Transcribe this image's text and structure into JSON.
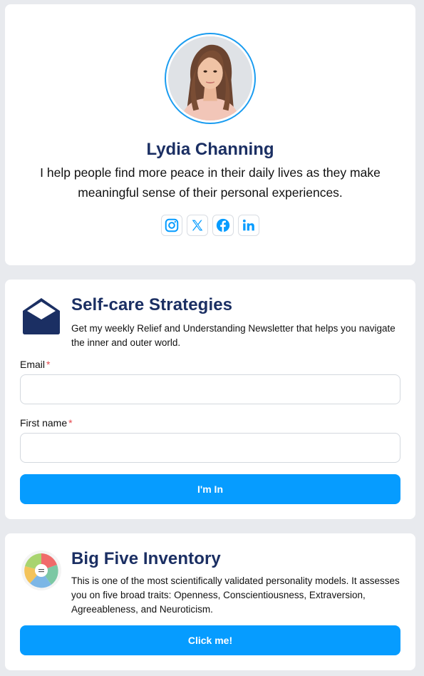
{
  "profile": {
    "name": "Lydia Channing",
    "bio": "I help people find more peace in their daily lives as they make meaningful sense of their personal experiences.",
    "avatar_icon": "portrait-photo",
    "socials": [
      {
        "name": "instagram",
        "icon": "instagram-icon"
      },
      {
        "name": "x",
        "icon": "x-icon"
      },
      {
        "name": "facebook",
        "icon": "facebook-icon"
      },
      {
        "name": "linkedin",
        "icon": "linkedin-icon"
      }
    ]
  },
  "newsletter": {
    "icon": "envelope-icon",
    "title": "Self-care Strategies",
    "description": "Get my weekly Relief and Understanding Newsletter that helps you navigate the inner and outer world.",
    "email_label": "Email",
    "email_value": "",
    "first_name_label": "First name",
    "first_name_value": "",
    "required_mark": "*",
    "submit_label": "I'm In"
  },
  "big_five": {
    "icon": "big-five-thumbnail",
    "title": "Big Five Inventory",
    "description": "This is one of the most scientifically validated personality models. It assesses you on five broad traits: Openness, Conscientiousness, Extraversion, Agreeableness, and Neuroticism.",
    "button_label": "Click me!"
  },
  "colors": {
    "accent": "#069cff",
    "heading": "#1b2f63",
    "background": "#e8eaee",
    "required": "#e5484d"
  }
}
